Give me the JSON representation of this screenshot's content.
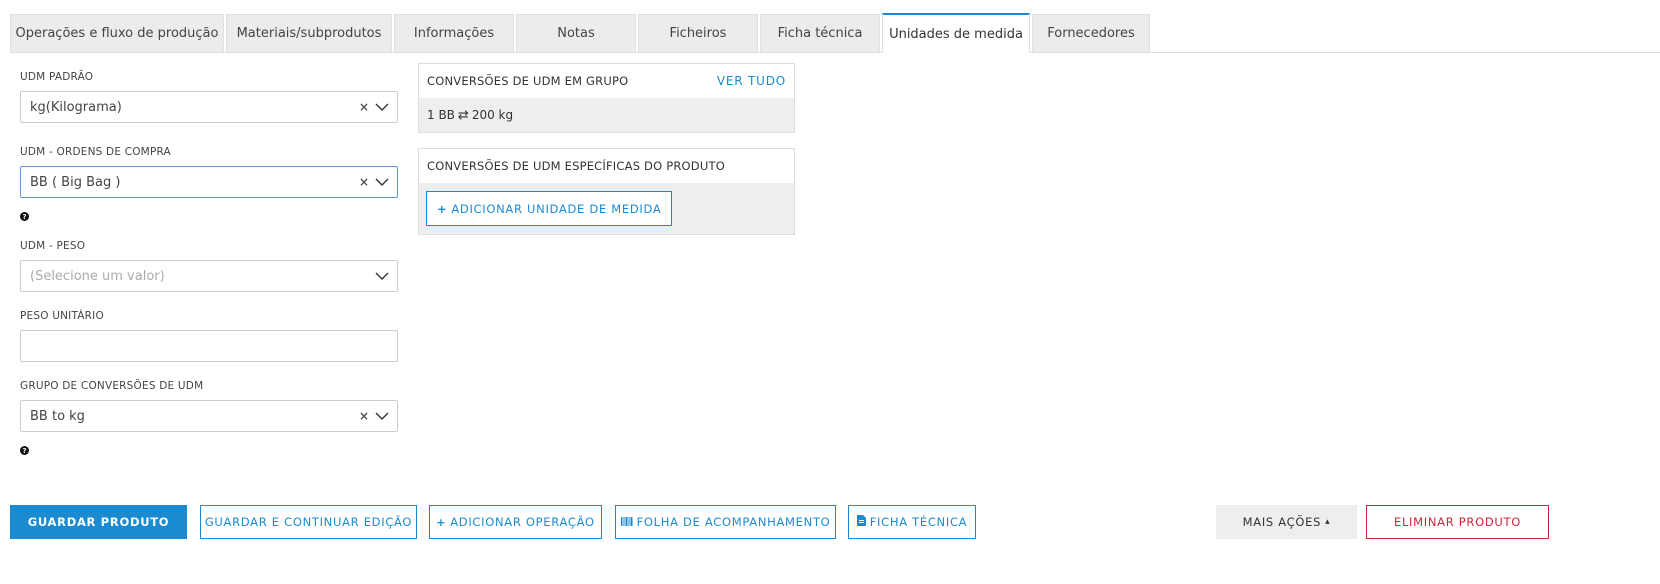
{
  "tabs": [
    {
      "label": "Operações e fluxo de produção",
      "active": false
    },
    {
      "label": "Materiais/subprodutos",
      "active": false
    },
    {
      "label": "Informações",
      "active": false
    },
    {
      "label": "Notas",
      "active": false
    },
    {
      "label": "Ficheiros",
      "active": false
    },
    {
      "label": "Ficha técnica",
      "active": false
    },
    {
      "label": "Unidades de medida",
      "active": true
    },
    {
      "label": "Fornecedores",
      "active": false
    }
  ],
  "form": {
    "uom_default": {
      "label": "UDM PADRÃO",
      "value": "kg(Kilograma)"
    },
    "uom_purchase": {
      "label": "UDM - ORDENS DE COMPRA",
      "value": "BB ( Big Bag )"
    },
    "uom_weight": {
      "label": "UDM - PESO",
      "placeholder": "(Selecione um valor)"
    },
    "unit_weight": {
      "label": "PESO UNITÁRIO",
      "value": ""
    },
    "conversion_group": {
      "label": "GRUPO DE CONVERSÕES DE UDM",
      "value": "BB to kg"
    },
    "clear_glyph": "×",
    "help_glyph": "?"
  },
  "group_panel": {
    "title": "CONVERSÕES DE UDM EM GRUPO",
    "link": "VER TUDO",
    "conversion": {
      "from": "1 BB",
      "arrows": "⇄",
      "to": "200 kg"
    }
  },
  "product_panel": {
    "title": "CONVERSÕES DE UDM ESPECÍFICAS DO PRODUTO",
    "add_icon": "+",
    "add_label": "ADICIONAR UNIDADE DE MEDIDA"
  },
  "toolbar": {
    "save": "GUARDAR PRODUTO",
    "save_continue": "GUARDAR E CONTINUAR EDIÇÃO",
    "add_operation_icon": "+",
    "add_operation": "ADICIONAR OPERAÇÃO",
    "tracking_sheet_icon": "barcode-icon",
    "tracking_sheet": "FOLHA DE ACOMPANHAMENTO",
    "tech_sheet_icon": "document-icon",
    "tech_sheet": "FICHA TÉCNICA",
    "more_actions": "MAIS AÇÕES",
    "more_actions_caret": "▴",
    "delete": "ELIMINAR PRODUTO"
  },
  "colors": {
    "accent": "#1a8bd1",
    "danger": "#c8283a",
    "panel_bg": "#eeeeee"
  }
}
